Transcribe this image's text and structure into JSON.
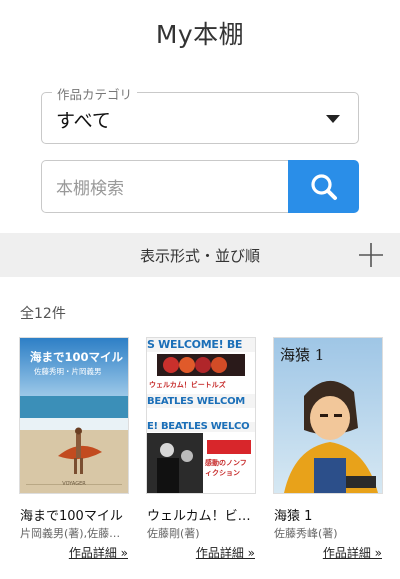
{
  "header": {
    "title": "My本棚"
  },
  "category": {
    "legend": "作品カテゴリ",
    "value": "すべて"
  },
  "search": {
    "placeholder": "本棚検索"
  },
  "sortbar": {
    "label": "表示形式・並び順"
  },
  "list": {
    "count": "全12件",
    "books": [
      {
        "title": "海まで100マイル",
        "author": "片岡義男(著),佐藤…",
        "detail": "作品詳細 »",
        "cover_title": "海まで100マイル",
        "cover_sub": "佐藤秀明・片岡義男",
        "cover_foot": "VOYAGER"
      },
      {
        "title": "ウェルカム！ビ…",
        "author": "佐藤剛(著)",
        "detail": "作品詳細 »",
        "cover_title": "ウェルカム！ビートルズ",
        "cover_banner": "S WELCOME! BE",
        "cover_banner2": "BEATLES WELCOM",
        "cover_banner3": "E! BEATLES WELCO",
        "cover_note": "感動のノンフィクション"
      },
      {
        "title": "海猿 1",
        "author": "佐藤秀峰(著)",
        "detail": "作品詳細 »",
        "cover_title": "海猿 1"
      }
    ]
  }
}
